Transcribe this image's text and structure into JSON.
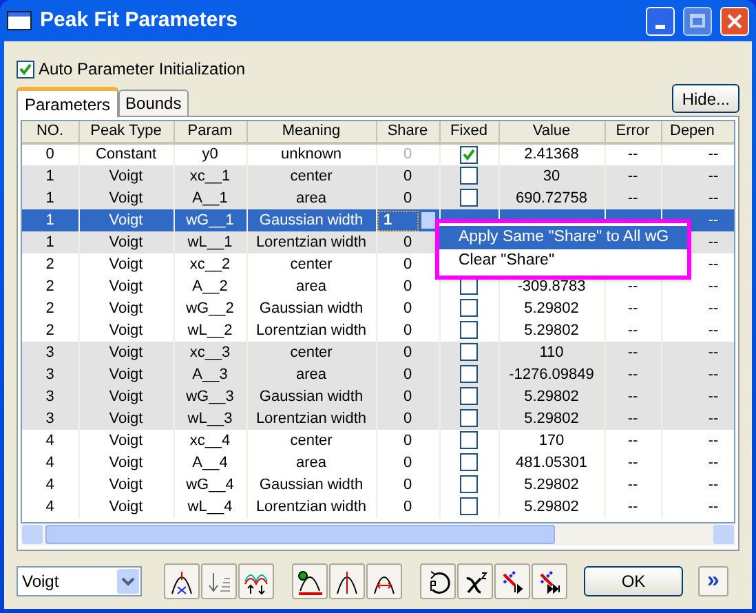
{
  "window": {
    "title": "Peak Fit Parameters"
  },
  "auto_init": {
    "label": "Auto Parameter Initialization",
    "checked": true
  },
  "tabs": [
    {
      "label": "Parameters",
      "selected": true
    },
    {
      "label": "Bounds",
      "selected": false
    }
  ],
  "hide_button": "Hide...",
  "table": {
    "columns": [
      "NO.",
      "Peak Type",
      "Param",
      "Meaning",
      "Share",
      "Fixed",
      "Value",
      "Error",
      "Depen"
    ],
    "rows": [
      {
        "no": "0",
        "type": "Constant",
        "param": "y0",
        "meaning": "unknown",
        "share": "0",
        "share_disabled": true,
        "fixed": true,
        "value": "2.41368",
        "error": "--",
        "depend": "--",
        "shaded": false,
        "selected": false
      },
      {
        "no": "1",
        "type": "Voigt",
        "param": "xc__1",
        "meaning": "center",
        "share": "0",
        "fixed": false,
        "value": "30",
        "error": "--",
        "depend": "--",
        "shaded": true,
        "selected": false
      },
      {
        "no": "1",
        "type": "Voigt",
        "param": "A__1",
        "meaning": "area",
        "share": "0",
        "fixed": false,
        "value": "690.72758",
        "error": "--",
        "depend": "--",
        "shaded": true,
        "selected": false
      },
      {
        "no": "1",
        "type": "Voigt",
        "param": "wG__1",
        "meaning": "Gaussian width",
        "share": "1",
        "depend": "--",
        "selected": true
      },
      {
        "no": "1",
        "type": "Voigt",
        "param": "wL__1",
        "meaning": "Lorentzian width",
        "share": "0",
        "depend": "--",
        "shaded": true,
        "selected": false
      },
      {
        "no": "2",
        "type": "Voigt",
        "param": "xc__2",
        "meaning": "center",
        "share": "0",
        "depend": "--",
        "shaded": false,
        "selected": false
      },
      {
        "no": "2",
        "type": "Voigt",
        "param": "A__2",
        "meaning": "area",
        "share": "0",
        "fixed": false,
        "value": "-309.8783",
        "error": "--",
        "depend": "--",
        "shaded": false,
        "selected": false
      },
      {
        "no": "2",
        "type": "Voigt",
        "param": "wG__2",
        "meaning": "Gaussian width",
        "share": "0",
        "fixed": false,
        "value": "5.29802",
        "error": "--",
        "depend": "--",
        "shaded": false,
        "selected": false
      },
      {
        "no": "2",
        "type": "Voigt",
        "param": "wL__2",
        "meaning": "Lorentzian width",
        "share": "0",
        "fixed": false,
        "value": "5.29802",
        "error": "--",
        "depend": "--",
        "shaded": false,
        "selected": false
      },
      {
        "no": "3",
        "type": "Voigt",
        "param": "xc__3",
        "meaning": "center",
        "share": "0",
        "fixed": false,
        "value": "110",
        "error": "--",
        "depend": "--",
        "shaded": true,
        "selected": false
      },
      {
        "no": "3",
        "type": "Voigt",
        "param": "A__3",
        "meaning": "area",
        "share": "0",
        "fixed": false,
        "value": "-1276.09849",
        "error": "--",
        "depend": "--",
        "shaded": true,
        "selected": false
      },
      {
        "no": "3",
        "type": "Voigt",
        "param": "wG__3",
        "meaning": "Gaussian width",
        "share": "0",
        "fixed": false,
        "value": "5.29802",
        "error": "--",
        "depend": "--",
        "shaded": true,
        "selected": false
      },
      {
        "no": "3",
        "type": "Voigt",
        "param": "wL__3",
        "meaning": "Lorentzian width",
        "share": "0",
        "fixed": false,
        "value": "5.29802",
        "error": "--",
        "depend": "--",
        "shaded": true,
        "selected": false
      },
      {
        "no": "4",
        "type": "Voigt",
        "param": "xc__4",
        "meaning": "center",
        "share": "0",
        "fixed": false,
        "value": "170",
        "error": "--",
        "depend": "--",
        "shaded": false,
        "selected": false
      },
      {
        "no": "4",
        "type": "Voigt",
        "param": "A__4",
        "meaning": "area",
        "share": "0",
        "fixed": false,
        "value": "481.05301",
        "error": "--",
        "depend": "--",
        "shaded": false,
        "selected": false
      },
      {
        "no": "4",
        "type": "Voigt",
        "param": "wG__4",
        "meaning": "Gaussian width",
        "share": "0",
        "fixed": false,
        "value": "5.29802",
        "error": "--",
        "depend": "--",
        "shaded": false,
        "selected": false
      },
      {
        "no": "4",
        "type": "Voigt",
        "param": "wL__4",
        "meaning": "Lorentzian width",
        "share": "0",
        "fixed": false,
        "value": "5.29802",
        "error": "--",
        "depend": "--",
        "shaded": false,
        "selected": false
      }
    ]
  },
  "context_menu": [
    {
      "label": "Apply Same \"Share\" to All wG",
      "selected": true
    },
    {
      "label": "Clear \"Share\"",
      "selected": false
    }
  ],
  "peak_type_dropdown": {
    "value": "Voigt"
  },
  "ok_button": "OK",
  "expand_button": "»"
}
